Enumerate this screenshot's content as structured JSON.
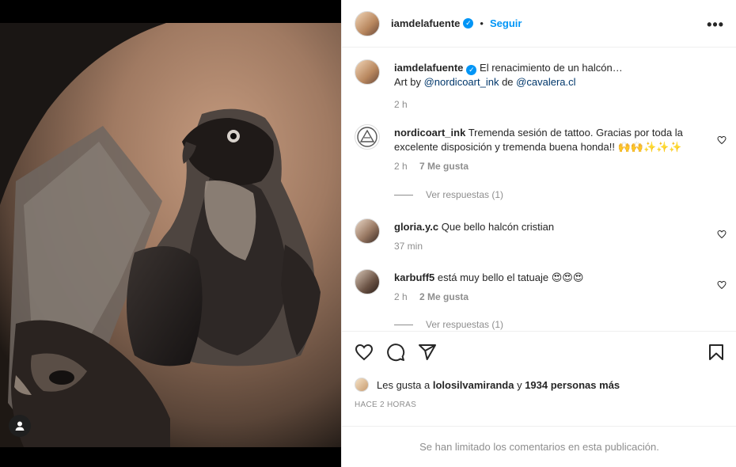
{
  "post": {
    "username": "iamdelafuente",
    "follow_label": "Seguir",
    "more_label": "•••"
  },
  "caption": {
    "username": "iamdelafuente",
    "text": "El renacimiento de un halcón…",
    "art_by": "Art by",
    "artist": "@nordicoart_ink",
    "de": "de",
    "studio": "@cavalera.cl",
    "time": "2 h"
  },
  "comments": [
    {
      "username": "nordicoart_ink",
      "text": "Tremenda sesión de tattoo. Gracias por toda la excelente disposición y tremenda buena honda!! 🙌🙌✨✨✨",
      "time": "2 h",
      "likes": "7 Me gusta",
      "replies": "Ver respuestas (1)"
    },
    {
      "username": "gloria.y.c",
      "text": "Que bello halcón cristian",
      "time": "37 min"
    },
    {
      "username": "karbuff5",
      "text": "está muy bello el tatuaje 😍😍😍",
      "time": "2 h",
      "likes": "2 Me gusta",
      "replies": "Ver respuestas (1)"
    }
  ],
  "likes": {
    "prefix": "Les gusta a",
    "user": "lolosilvamiranda",
    "connector": "y",
    "others": "1934 personas más"
  },
  "timestamp": "HACE 2 HORAS",
  "limited_notice": "Se han limitado los comentarios en esta publicación.",
  "icons": {
    "like": "heart-icon",
    "comment": "comment-icon",
    "share": "send-icon",
    "save": "bookmark-icon",
    "user_tag": "user-tag-icon",
    "verified": "verified-badge-icon"
  },
  "colors": {
    "accent": "#0095f6",
    "link": "#00376b",
    "muted": "#8e8e8e"
  }
}
